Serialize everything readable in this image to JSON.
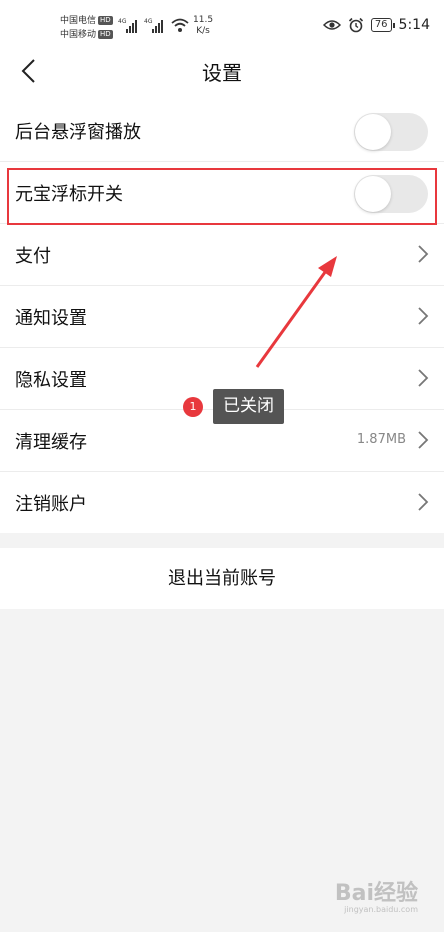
{
  "status_bar": {
    "carrier_1": "中国电信",
    "carrier_2": "中国移动",
    "hd_label": "HD",
    "net_type": "4G",
    "speed_value": "11.5",
    "speed_unit": "K/s",
    "battery": "76",
    "time": "5:14"
  },
  "header": {
    "title": "设置"
  },
  "settings": {
    "bg_float_play": {
      "label": "后台悬浮窗播放",
      "toggle_on": false
    },
    "yuanbao_float": {
      "label": "元宝浮标开关",
      "toggle_on": false
    },
    "payment": {
      "label": "支付"
    },
    "notification": {
      "label": "通知设置"
    },
    "privacy": {
      "label": "隐私设置"
    },
    "clear_cache": {
      "label": "清理缓存",
      "value": "1.87MB"
    },
    "delete_account": {
      "label": "注销账户"
    }
  },
  "logout": {
    "label": "退出当前账号"
  },
  "annotation": {
    "badge_number": "1",
    "text": "已关闭",
    "color": "#e8383d"
  },
  "watermark": {
    "main": "Bai经验",
    "sub": "jingyan.baidu.com"
  },
  "colors": {
    "highlight": "#e8383d",
    "toggle_off": "#e8e8e8",
    "tooltip_bg": "#545454"
  }
}
